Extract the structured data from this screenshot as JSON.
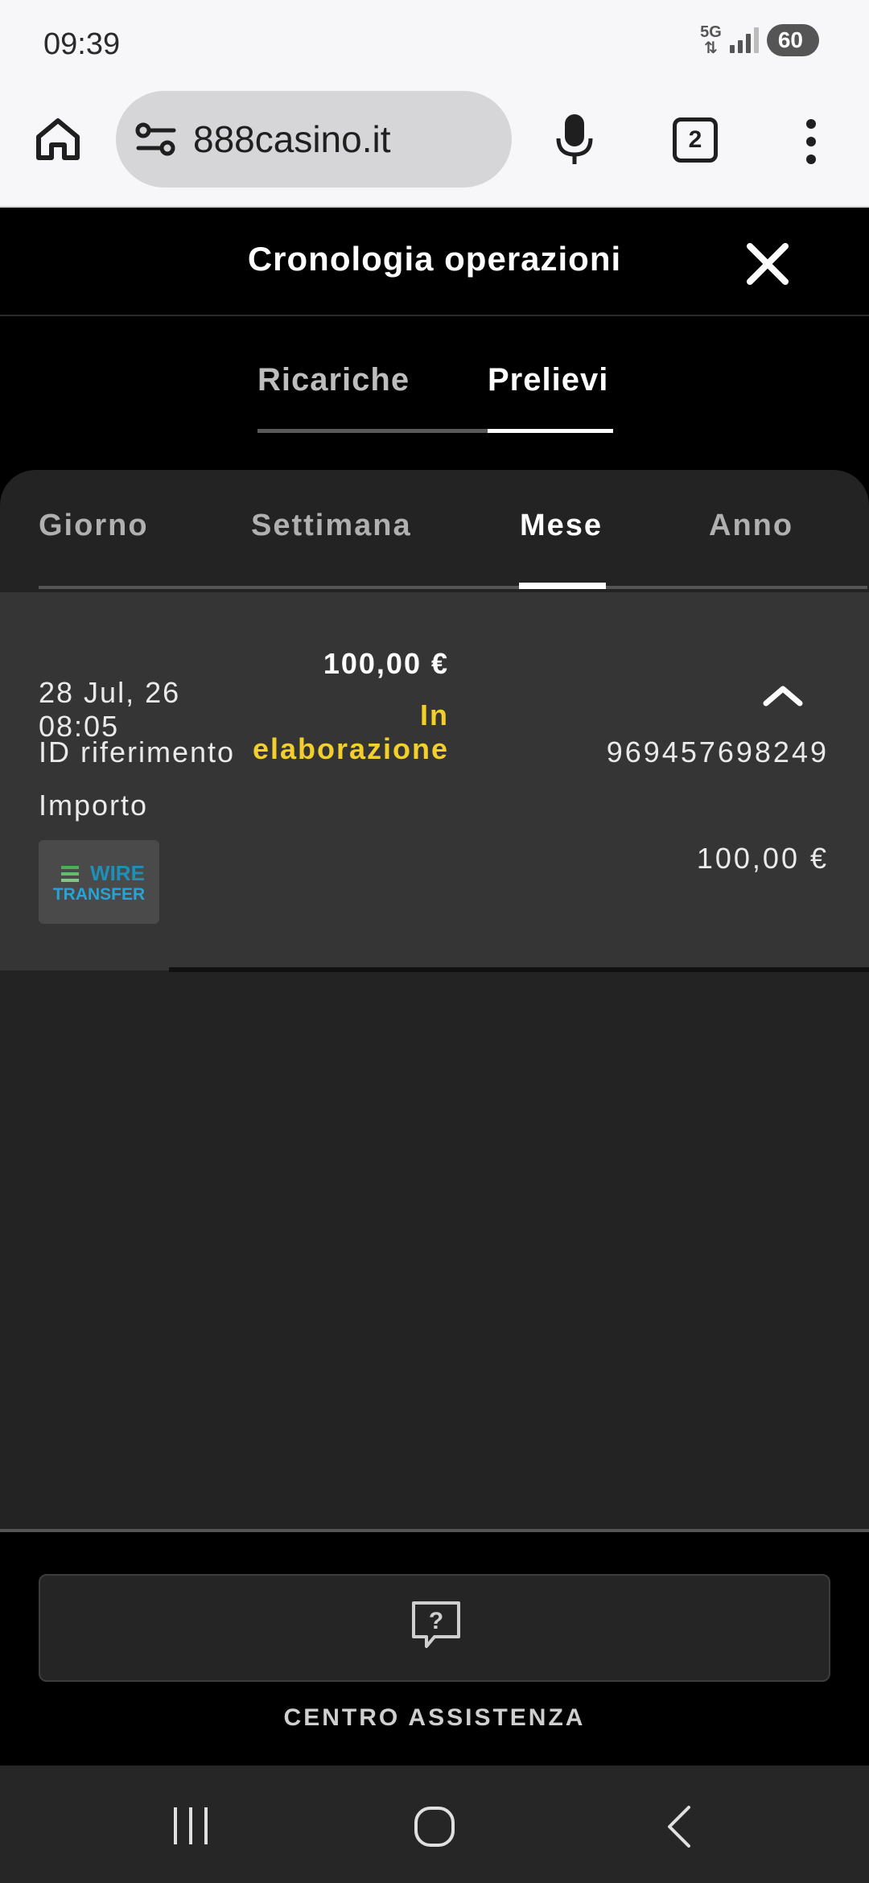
{
  "status_bar": {
    "time": "09:39",
    "network": "5G",
    "battery": "60"
  },
  "browser": {
    "url": "888casino.it",
    "tab_count": "2"
  },
  "header": {
    "title": "Cronologia operazioni"
  },
  "type_tabs": [
    {
      "label": "Ricariche",
      "active": false
    },
    {
      "label": "Prelievi",
      "active": true
    }
  ],
  "period_tabs": [
    {
      "label": "Giorno",
      "active": false
    },
    {
      "label": "Settimana",
      "active": false
    },
    {
      "label": "Mese",
      "active": true
    },
    {
      "label": "Anno",
      "active": false
    }
  ],
  "transaction": {
    "date": "28 Jul, 26",
    "time": "08:05",
    "amount": "100,00 €",
    "status_line1": "In",
    "status_line2": "elaborazione",
    "status_color": "#f2cf2b",
    "reference_label": "ID riferimento",
    "reference_value": "969457698249",
    "amount_label": "Importo",
    "amount_value": "100,00 €",
    "method_logo_top": "WIRE",
    "method_logo_bottom": "TRANSFER"
  },
  "footer": {
    "help_label": "CENTRO ASSISTENZA"
  },
  "icons": [
    "home-icon",
    "tune-icon",
    "mic-icon",
    "tabs-icon",
    "more-vert-icon",
    "close-icon",
    "chevron-up-icon",
    "help-chat-icon",
    "recents-icon",
    "home-circle-icon",
    "back-icon"
  ]
}
